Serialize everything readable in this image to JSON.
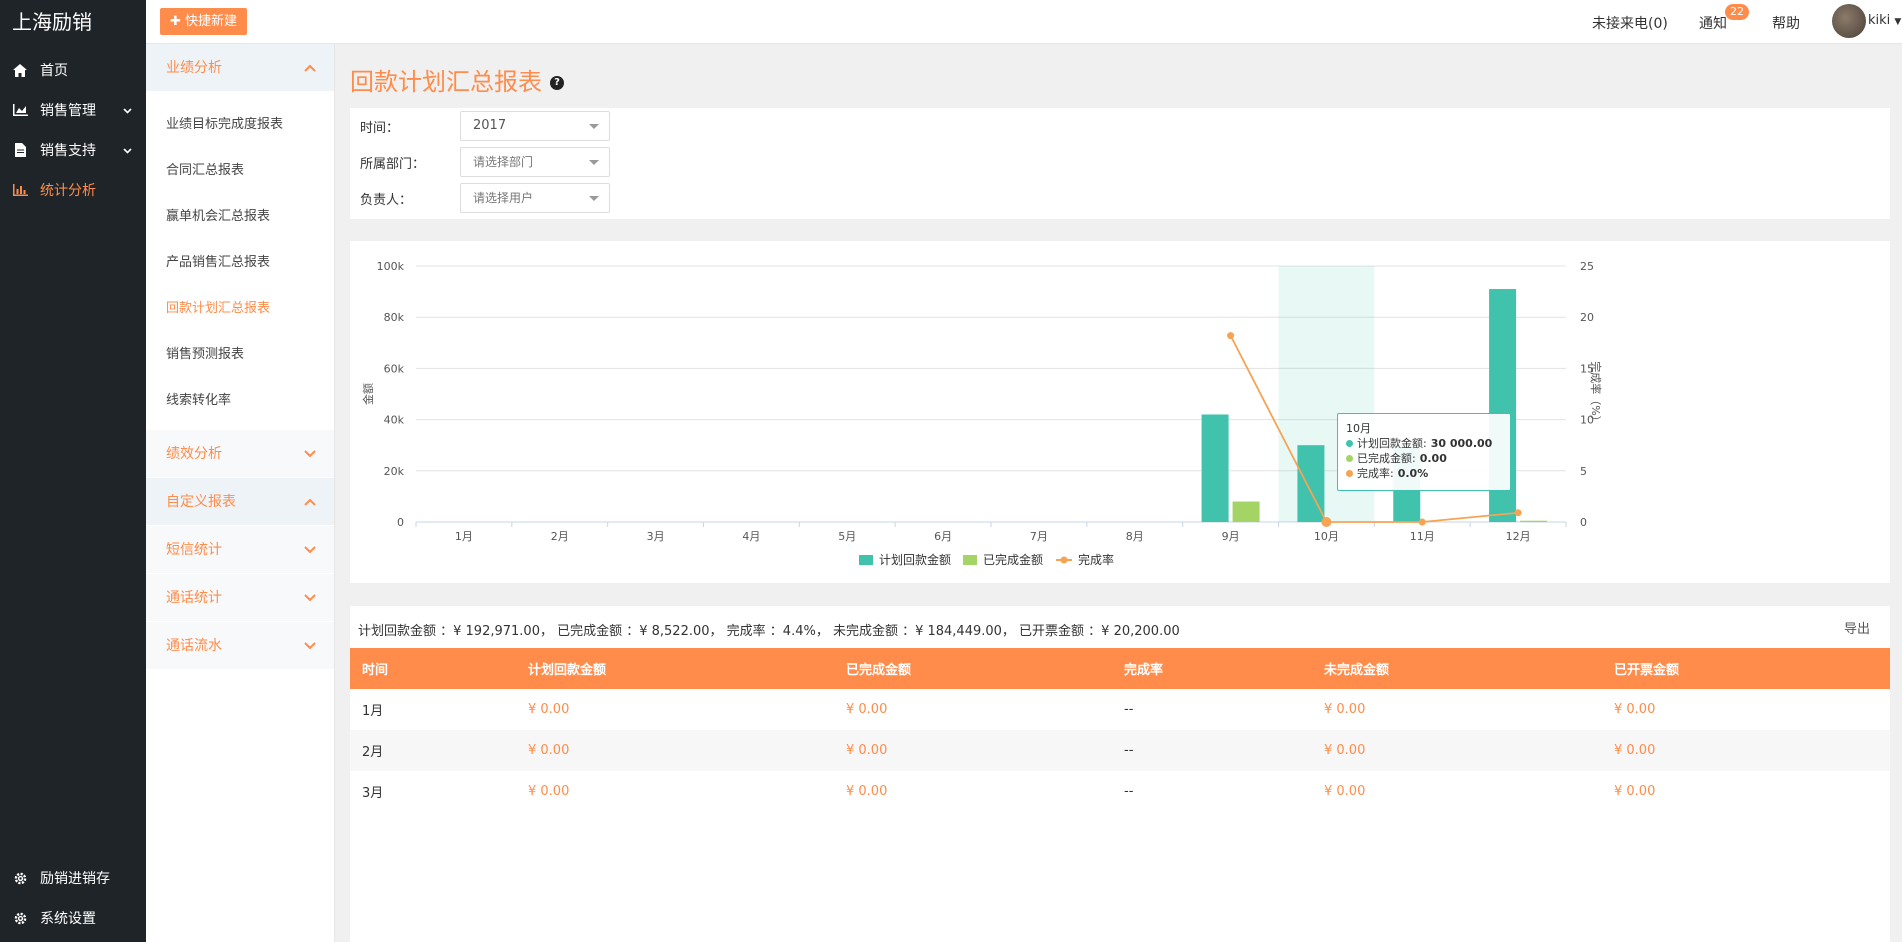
{
  "brand": "上海励销",
  "sidebar": {
    "items": [
      {
        "label": "首页",
        "icon": "home-icon"
      },
      {
        "label": "销售管理",
        "icon": "chart-area-icon"
      },
      {
        "label": "销售支持",
        "icon": "document-icon"
      },
      {
        "label": "统计分析",
        "icon": "bar-chart-icon"
      }
    ],
    "bottom_items": [
      {
        "label": "励销进销存",
        "icon": "gear-icon"
      },
      {
        "label": "系统设置",
        "icon": "gear-icon"
      }
    ]
  },
  "header": {
    "quick_new": "快捷新建",
    "missed_calls": "未接来电(0)",
    "notify": "通知",
    "notify_count": "22",
    "help": "帮助",
    "user": "kiki"
  },
  "subnav": {
    "group_business": "业绩分析",
    "links": [
      "业绩目标完成度报表",
      "合同汇总报表",
      "赢单机会汇总报表",
      "产品销售汇总报表",
      "回款计划汇总报表",
      "销售预测报表",
      "线索转化率"
    ],
    "groups": [
      "绩效分析",
      "自定义报表",
      "短信统计",
      "通话统计",
      "通话流水"
    ]
  },
  "page": {
    "title": "回款计划汇总报表"
  },
  "filters": {
    "time_label": "时间：",
    "time_value": "2017",
    "dept_label": "所属部门：",
    "dept_placeholder": "请选择部门",
    "owner_label": "负责人：",
    "owner_placeholder": "请选择用户"
  },
  "chart_data": {
    "type": "bar",
    "categories": [
      "1月",
      "2月",
      "3月",
      "4月",
      "5月",
      "6月",
      "7月",
      "8月",
      "9月",
      "10月",
      "11月",
      "12月"
    ],
    "series": [
      {
        "name": "计划回款金额",
        "type": "bar",
        "color": "#40c2ad",
        "values": [
          0,
          0,
          0,
          0,
          0,
          0,
          0,
          0,
          42000,
          30000,
          30000,
          91000
        ]
      },
      {
        "name": "已完成金额",
        "type": "bar",
        "color": "#a3d465",
        "values": [
          0,
          0,
          0,
          0,
          0,
          0,
          0,
          0,
          8000,
          0,
          0,
          500
        ]
      },
      {
        "name": "完成率",
        "type": "line",
        "axis": "right",
        "color": "#f7a354",
        "values": [
          null,
          null,
          null,
          null,
          null,
          null,
          null,
          null,
          18.2,
          0.0,
          0.0,
          0.9
        ]
      }
    ],
    "ylabel": "金额",
    "ylabel_right": "完成率（%）",
    "ylim": [
      0,
      100000
    ],
    "yticks": [
      "0",
      "20k",
      "40k",
      "60k",
      "80k",
      "100k"
    ],
    "ylim_right": [
      0,
      25
    ],
    "yticks_right": [
      "0",
      "5",
      "10",
      "15",
      "20",
      "25"
    ],
    "legend_position": "bottom-center",
    "grid": true,
    "tooltip": {
      "title": "10月",
      "rows": [
        {
          "label": "计划回款金额:",
          "value": "30 000.00",
          "color": "#40c2ad"
        },
        {
          "label": "已完成金额:",
          "value": "0.00",
          "color": "#a3d465"
        },
        {
          "label": "完成率:",
          "value": "0.0%",
          "color": "#f7a354"
        }
      ]
    }
  },
  "summary": {
    "text": "计划回款金额 ：¥ 192,971.00， 已完成金额 ：¥ 8,522.00， 完成率 ：4.4%， 未完成金额 ：¥ 184,449.00， 已开票金额 ：¥ 20,200.00",
    "export": "导出"
  },
  "table": {
    "headers": [
      "时间",
      "计划回款金额",
      "已完成金额",
      "完成率",
      "未完成金额",
      "已开票金额"
    ],
    "rows": [
      [
        "1月",
        "¥ 0.00",
        "¥ 0.00",
        "--",
        "¥ 0.00",
        "¥ 0.00"
      ],
      [
        "2月",
        "¥ 0.00",
        "¥ 0.00",
        "--",
        "¥ 0.00",
        "¥ 0.00"
      ],
      [
        "3月",
        "¥ 0.00",
        "¥ 0.00",
        "--",
        "¥ 0.00",
        "¥ 0.00"
      ]
    ]
  }
}
